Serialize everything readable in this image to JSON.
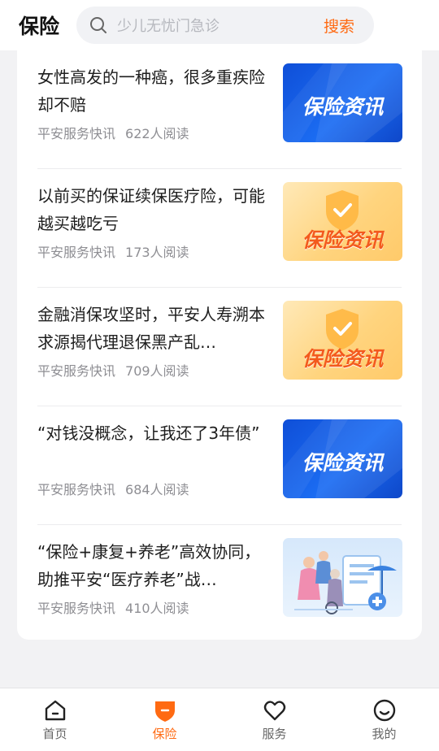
{
  "header": {
    "title": "保险",
    "search_placeholder": "少儿无忧门急诊",
    "search_button": "搜索"
  },
  "articles": [
    {
      "title": "女性高发的一种癌，很多重疾险却不赔",
      "source": "平安服务快讯",
      "reads": "622人阅读",
      "thumb": "blue",
      "thumb_text": "保险资讯"
    },
    {
      "title": "以前买的保证续保医疗险，可能越买越吃亏",
      "source": "平安服务快讯",
      "reads": "173人阅读",
      "thumb": "orange",
      "thumb_text": "保险资讯"
    },
    {
      "title": "金融消保攻坚时，平安人寿溯本求源揭代理退保黑产乱…",
      "source": "平安服务快讯",
      "reads": "709人阅读",
      "thumb": "orange",
      "thumb_text": "保险资讯"
    },
    {
      "title": "“对钱没概念，让我还了3年债”",
      "source": "平安服务快讯",
      "reads": "684人阅读",
      "thumb": "blue",
      "thumb_text": "保险资讯"
    },
    {
      "title": "“保险+康复+养老”高效协同，助推平安“医疗养老”战…",
      "source": "平安服务快讯",
      "reads": "410人阅读",
      "thumb": "illustration",
      "thumb_text": ""
    }
  ],
  "tabbar": [
    {
      "label": "首页",
      "icon": "home-icon",
      "active": false
    },
    {
      "label": "保险",
      "icon": "shield-icon",
      "active": true
    },
    {
      "label": "服务",
      "icon": "heart-icon",
      "active": false
    },
    {
      "label": "我的",
      "icon": "smile-icon",
      "active": false
    }
  ],
  "colors": {
    "accent": "#ff6a12",
    "blue_thumb": "#1b6cf2",
    "orange_thumb": "#ffd47e"
  }
}
